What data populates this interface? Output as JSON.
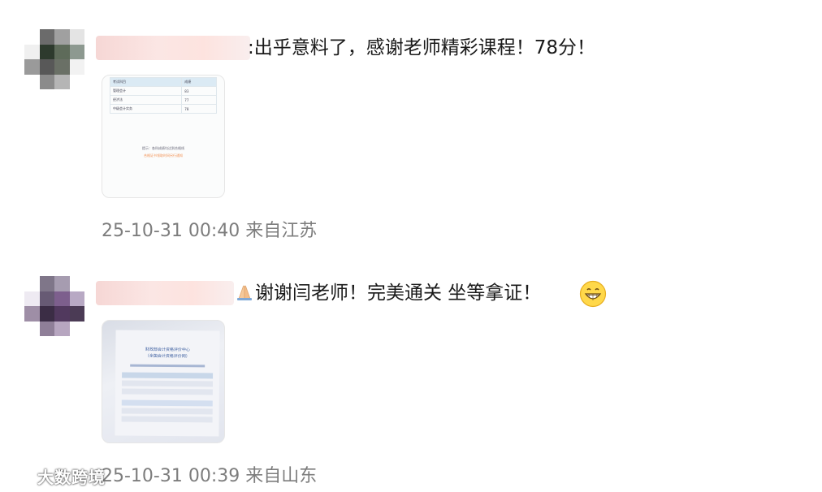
{
  "comments": [
    {
      "message": ":出乎意料了，感谢老师精彩课程！78分！",
      "time": "25-10-31 00:40 来自江苏",
      "thumb_table": [
        {
          "name": "考试科目",
          "score": "成绩"
        },
        {
          "name": "管理会计",
          "score": "83"
        },
        {
          "name": "经济法",
          "score": "77"
        },
        {
          "name": "中级会计实务",
          "score": "78"
        }
      ],
      "thumb_note": "提示：各科成绩均达到合格线",
      "thumb_note2": "合格证书领取时间另行通知"
    },
    {
      "message": "谢谢闫老师！完美通关 坐等拿证！",
      "time": "25-10-31 00:39 来自山东",
      "thumb_title": "财政部会计资格评价中心",
      "thumb_subtitle": "（全国会计资格评价网）"
    }
  ],
  "watermark": "大数跨境",
  "colors": {
    "time": "#7d7d7d",
    "accent_orange": "#f29255"
  }
}
